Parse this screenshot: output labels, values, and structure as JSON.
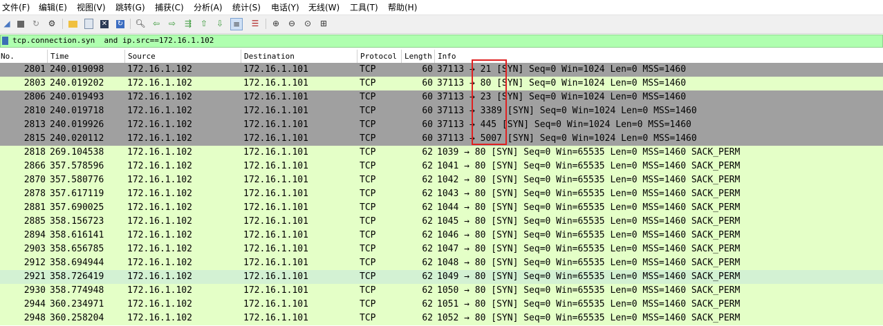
{
  "menu": [
    "文件(F)",
    "编辑(E)",
    "视图(V)",
    "跳转(G)",
    "捕获(C)",
    "分析(A)",
    "统计(S)",
    "电话(Y)",
    "无线(W)",
    "工具(T)",
    "帮助(H)"
  ],
  "toolbar": {
    "icons": [
      "shark-fin-start-icon",
      "stop-icon",
      "restart-icon",
      "options-gear-icon",
      "open-folder-icon",
      "save-file-icon",
      "close-file-icon",
      "reload-icon",
      "find-icon",
      "back-arrow-icon",
      "forward-arrow-icon",
      "go-to-packet-icon",
      "first-packet-icon",
      "last-packet-icon",
      "autoscroll-icon",
      "colorize-icon",
      "zoom-in-icon",
      "zoom-out-icon",
      "normal-size-icon",
      "resize-columns-icon"
    ]
  },
  "filter": {
    "text": "tcp.connection.syn  and ip.src==172.16.1.102"
  },
  "columns": [
    "No.",
    "Time",
    "Source",
    "Destination",
    "Protocol",
    "Length",
    "Info"
  ],
  "colors": {
    "row_gray": "#a0a0a0",
    "row_green": "#e4ffc7",
    "row_selected_green": "#d3f1d3",
    "filter_bg": "#afffaf",
    "highlight_border": "#e02020"
  },
  "packets": [
    {
      "no": "2801",
      "time": "240.019098",
      "src": "172.16.1.102",
      "dst": "172.16.1.101",
      "proto": "TCP",
      "len": "60",
      "info": "37113 → 21 [SYN] Seq=0 Win=1024 Len=0 MSS=1460",
      "style": "gray"
    },
    {
      "no": "2803",
      "time": "240.019202",
      "src": "172.16.1.102",
      "dst": "172.16.1.101",
      "proto": "TCP",
      "len": "60",
      "info": "37113 → 80 [SYN] Seq=0 Win=1024 Len=0 MSS=1460",
      "style": "green"
    },
    {
      "no": "2806",
      "time": "240.019493",
      "src": "172.16.1.102",
      "dst": "172.16.1.101",
      "proto": "TCP",
      "len": "60",
      "info": "37113 → 23 [SYN] Seq=0 Win=1024 Len=0 MSS=1460",
      "style": "gray"
    },
    {
      "no": "2810",
      "time": "240.019718",
      "src": "172.16.1.102",
      "dst": "172.16.1.101",
      "proto": "TCP",
      "len": "60",
      "info": "37113 → 3389 [SYN] Seq=0 Win=1024 Len=0 MSS=1460",
      "style": "gray"
    },
    {
      "no": "2813",
      "time": "240.019926",
      "src": "172.16.1.102",
      "dst": "172.16.1.101",
      "proto": "TCP",
      "len": "60",
      "info": "37113 → 445 [SYN] Seq=0 Win=1024 Len=0 MSS=1460",
      "style": "gray"
    },
    {
      "no": "2815",
      "time": "240.020112",
      "src": "172.16.1.102",
      "dst": "172.16.1.101",
      "proto": "TCP",
      "len": "60",
      "info": "37113 → 5007 [SYN] Seq=0 Win=1024 Len=0 MSS=1460",
      "style": "gray"
    },
    {
      "no": "2818",
      "time": "269.104538",
      "src": "172.16.1.102",
      "dst": "172.16.1.101",
      "proto": "TCP",
      "len": "62",
      "info": "1039 → 80 [SYN] Seq=0 Win=65535 Len=0 MSS=1460 SACK_PERM",
      "style": "green"
    },
    {
      "no": "2866",
      "time": "357.578596",
      "src": "172.16.1.102",
      "dst": "172.16.1.101",
      "proto": "TCP",
      "len": "62",
      "info": "1041 → 80 [SYN] Seq=0 Win=65535 Len=0 MSS=1460 SACK_PERM",
      "style": "green"
    },
    {
      "no": "2870",
      "time": "357.580776",
      "src": "172.16.1.102",
      "dst": "172.16.1.101",
      "proto": "TCP",
      "len": "62",
      "info": "1042 → 80 [SYN] Seq=0 Win=65535 Len=0 MSS=1460 SACK_PERM",
      "style": "green"
    },
    {
      "no": "2878",
      "time": "357.617119",
      "src": "172.16.1.102",
      "dst": "172.16.1.101",
      "proto": "TCP",
      "len": "62",
      "info": "1043 → 80 [SYN] Seq=0 Win=65535 Len=0 MSS=1460 SACK_PERM",
      "style": "green"
    },
    {
      "no": "2881",
      "time": "357.690025",
      "src": "172.16.1.102",
      "dst": "172.16.1.101",
      "proto": "TCP",
      "len": "62",
      "info": "1044 → 80 [SYN] Seq=0 Win=65535 Len=0 MSS=1460 SACK_PERM",
      "style": "green"
    },
    {
      "no": "2885",
      "time": "358.156723",
      "src": "172.16.1.102",
      "dst": "172.16.1.101",
      "proto": "TCP",
      "len": "62",
      "info": "1045 → 80 [SYN] Seq=0 Win=65535 Len=0 MSS=1460 SACK_PERM",
      "style": "green"
    },
    {
      "no": "2894",
      "time": "358.616141",
      "src": "172.16.1.102",
      "dst": "172.16.1.101",
      "proto": "TCP",
      "len": "62",
      "info": "1046 → 80 [SYN] Seq=0 Win=65535 Len=0 MSS=1460 SACK_PERM",
      "style": "green"
    },
    {
      "no": "2903",
      "time": "358.656785",
      "src": "172.16.1.102",
      "dst": "172.16.1.101",
      "proto": "TCP",
      "len": "62",
      "info": "1047 → 80 [SYN] Seq=0 Win=65535 Len=0 MSS=1460 SACK_PERM",
      "style": "green"
    },
    {
      "no": "2912",
      "time": "358.694944",
      "src": "172.16.1.102",
      "dst": "172.16.1.101",
      "proto": "TCP",
      "len": "62",
      "info": "1048 → 80 [SYN] Seq=0 Win=65535 Len=0 MSS=1460 SACK_PERM",
      "style": "green"
    },
    {
      "no": "2921",
      "time": "358.726419",
      "src": "172.16.1.102",
      "dst": "172.16.1.101",
      "proto": "TCP",
      "len": "62",
      "info": "1049 → 80 [SYN] Seq=0 Win=65535 Len=0 MSS=1460 SACK_PERM",
      "style": "selected"
    },
    {
      "no": "2930",
      "time": "358.774948",
      "src": "172.16.1.102",
      "dst": "172.16.1.101",
      "proto": "TCP",
      "len": "62",
      "info": "1050 → 80 [SYN] Seq=0 Win=65535 Len=0 MSS=1460 SACK_PERM",
      "style": "green"
    },
    {
      "no": "2944",
      "time": "360.234971",
      "src": "172.16.1.102",
      "dst": "172.16.1.101",
      "proto": "TCP",
      "len": "62",
      "info": "1051 → 80 [SYN] Seq=0 Win=65535 Len=0 MSS=1460 SACK_PERM",
      "style": "green"
    },
    {
      "no": "2948",
      "time": "360.258204",
      "src": "172.16.1.102",
      "dst": "172.16.1.101",
      "proto": "TCP",
      "len": "62",
      "info": "1052 → 80 [SYN] Seq=0 Win=65535 Len=0 MSS=1460 SACK_PERM",
      "style": "green"
    }
  ]
}
